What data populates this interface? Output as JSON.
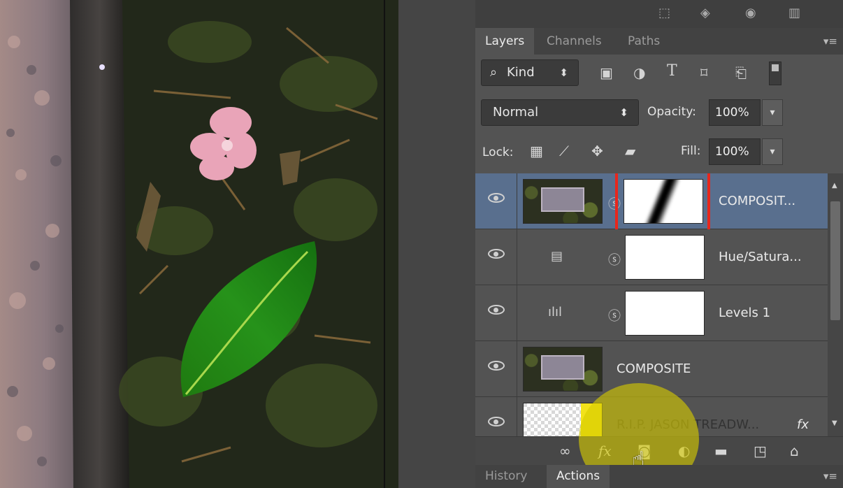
{
  "panel_tabs": [
    "Layers",
    "Channels",
    "Paths"
  ],
  "filter": {
    "kind_label": "Kind",
    "icons": [
      "image-filter-icon",
      "adjustment-filter-icon",
      "type-filter-icon",
      "shape-filter-icon",
      "smart-object-filter-icon"
    ]
  },
  "blend": {
    "mode": "Normal",
    "opacity_label": "Opacity:",
    "opacity_value": "100%"
  },
  "lock": {
    "label": "Lock:",
    "fill_label": "Fill:",
    "fill_value": "100%"
  },
  "layers": [
    {
      "name": "COMPOSIT...",
      "kind": "pixel-with-mask",
      "selected": true,
      "visible": true
    },
    {
      "name": "Hue/Satura...",
      "kind": "hue-saturation-adjustment",
      "selected": false,
      "visible": true
    },
    {
      "name": "Levels 1",
      "kind": "levels-adjustment",
      "selected": false,
      "visible": true
    },
    {
      "name": "COMPOSITE",
      "kind": "pixel",
      "selected": false,
      "visible": true
    },
    {
      "name": "R.I.P. JASON TREADW...",
      "kind": "pixel-with-fx",
      "selected": false,
      "visible": true
    }
  ],
  "bottom_icons": [
    "link-layers-icon",
    "fx-icon",
    "add-mask-icon",
    "adjustment-layer-icon",
    "new-group-icon",
    "new-layer-icon",
    "trash-icon"
  ],
  "fx_label": "fx",
  "history_tabs": [
    "History",
    "Actions"
  ],
  "colors": {
    "panel_bg": "#535353",
    "selected_layer": "#596f8e",
    "highlight_box": "#e8261c",
    "cursor_spotlight": "#d6cc00"
  }
}
